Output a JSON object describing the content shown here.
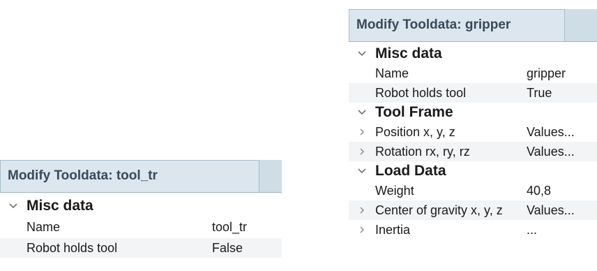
{
  "left_panel": {
    "tab_title": "Modify Tooldata: tool_tr",
    "groups": [
      {
        "title": "Misc data",
        "rows": [
          {
            "label": "Name",
            "value": "tool_tr"
          },
          {
            "label": "Robot holds tool",
            "value": "False"
          }
        ]
      }
    ]
  },
  "right_panel": {
    "tab_title": "Modify Tooldata: gripper",
    "groups": [
      {
        "title": "Misc data",
        "rows": [
          {
            "label": "Name",
            "value": "gripper"
          },
          {
            "label": "Robot holds tool",
            "value": "True"
          }
        ]
      },
      {
        "title": "Tool Frame",
        "rows": [
          {
            "label": "Position x, y, z",
            "value": "Values..."
          },
          {
            "label": "Rotation rx, ry, rz",
            "value": "Values..."
          }
        ]
      },
      {
        "title": "Load Data",
        "rows": [
          {
            "label": "Weight",
            "value": "40,8"
          },
          {
            "label": "Center of gravity x, y, z",
            "value": "Values..."
          },
          {
            "label": "Inertia",
            "value": "..."
          }
        ]
      }
    ]
  },
  "icons": {
    "expanded": "chevron-down-icon",
    "collapsed": "chevron-right-icon"
  }
}
